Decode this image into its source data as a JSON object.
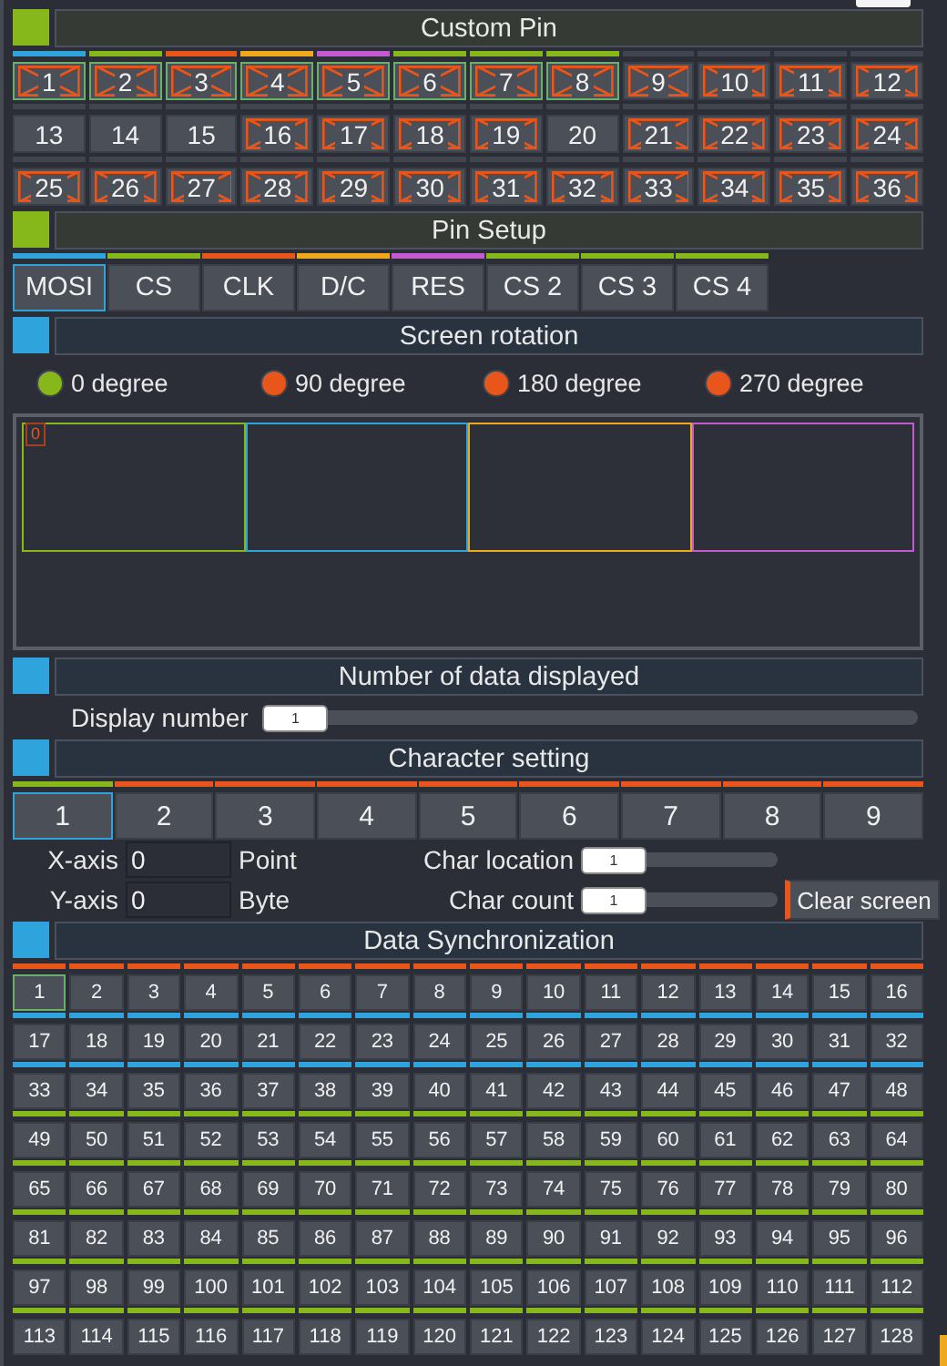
{
  "custom_pin": {
    "title": "Custom Pin",
    "color": "#86b81c",
    "pins": [
      {
        "label": "1",
        "color": "#2ea3dc",
        "crossed": true,
        "assigned": true
      },
      {
        "label": "2",
        "color": "#86b81c",
        "crossed": true,
        "assigned": true
      },
      {
        "label": "3",
        "color": "#e8561c",
        "crossed": true,
        "assigned": true
      },
      {
        "label": "4",
        "color": "#f0a81c",
        "crossed": true,
        "assigned": true
      },
      {
        "label": "5",
        "color": "#c45ad0",
        "crossed": true,
        "assigned": true
      },
      {
        "label": "6",
        "color": "#86b81c",
        "crossed": true,
        "assigned": true
      },
      {
        "label": "7",
        "color": "#86b81c",
        "crossed": true,
        "assigned": true
      },
      {
        "label": "8",
        "color": "#86b81c",
        "crossed": true,
        "assigned": true
      },
      {
        "label": "9",
        "color": "#41464e",
        "crossed": true,
        "assigned": false
      },
      {
        "label": "10",
        "color": "#41464e",
        "crossed": true,
        "assigned": false
      },
      {
        "label": "11",
        "color": "#41464e",
        "crossed": true,
        "assigned": false
      },
      {
        "label": "12",
        "color": "#41464e",
        "crossed": true,
        "assigned": false
      },
      {
        "label": "13",
        "color": "#41464e",
        "crossed": false,
        "assigned": false
      },
      {
        "label": "14",
        "color": "#41464e",
        "crossed": false,
        "assigned": false
      },
      {
        "label": "15",
        "color": "#41464e",
        "crossed": false,
        "assigned": false
      },
      {
        "label": "16",
        "color": "#41464e",
        "crossed": true,
        "assigned": false
      },
      {
        "label": "17",
        "color": "#41464e",
        "crossed": true,
        "assigned": false
      },
      {
        "label": "18",
        "color": "#41464e",
        "crossed": true,
        "assigned": false
      },
      {
        "label": "19",
        "color": "#41464e",
        "crossed": true,
        "assigned": false
      },
      {
        "label": "20",
        "color": "#41464e",
        "crossed": false,
        "assigned": false
      },
      {
        "label": "21",
        "color": "#41464e",
        "crossed": true,
        "assigned": false
      },
      {
        "label": "22",
        "color": "#41464e",
        "crossed": true,
        "assigned": false
      },
      {
        "label": "23",
        "color": "#41464e",
        "crossed": true,
        "assigned": false
      },
      {
        "label": "24",
        "color": "#41464e",
        "crossed": true,
        "assigned": false
      },
      {
        "label": "25",
        "color": "#41464e",
        "crossed": true,
        "assigned": false
      },
      {
        "label": "26",
        "color": "#41464e",
        "crossed": true,
        "assigned": false
      },
      {
        "label": "27",
        "color": "#41464e",
        "crossed": true,
        "assigned": false
      },
      {
        "label": "28",
        "color": "#41464e",
        "crossed": true,
        "assigned": false
      },
      {
        "label": "29",
        "color": "#41464e",
        "crossed": true,
        "assigned": false
      },
      {
        "label": "30",
        "color": "#41464e",
        "crossed": true,
        "assigned": false
      },
      {
        "label": "31",
        "color": "#41464e",
        "crossed": true,
        "assigned": false
      },
      {
        "label": "32",
        "color": "#41464e",
        "crossed": true,
        "assigned": false
      },
      {
        "label": "33",
        "color": "#41464e",
        "crossed": true,
        "assigned": false
      },
      {
        "label": "34",
        "color": "#41464e",
        "crossed": true,
        "assigned": false
      },
      {
        "label": "35",
        "color": "#41464e",
        "crossed": true,
        "assigned": false
      },
      {
        "label": "36",
        "color": "#41464e",
        "crossed": true,
        "assigned": false
      }
    ]
  },
  "pin_setup": {
    "title": "Pin Setup",
    "color": "#86b81c",
    "tabs": [
      {
        "label": "MOSI",
        "color": "#2ea3dc",
        "selected": true
      },
      {
        "label": "CS",
        "color": "#86b81c",
        "selected": false
      },
      {
        "label": "CLK",
        "color": "#e8561c",
        "selected": false
      },
      {
        "label": "D/C",
        "color": "#f0a81c",
        "selected": false
      },
      {
        "label": "RES",
        "color": "#c45ad0",
        "selected": false
      },
      {
        "label": "CS 2",
        "color": "#86b81c",
        "selected": false
      },
      {
        "label": "CS 3",
        "color": "#86b81c",
        "selected": false
      },
      {
        "label": "CS 4",
        "color": "#86b81c",
        "selected": false
      }
    ]
  },
  "screen_rotation": {
    "title": "Screen rotation",
    "color": "#2ea3dc",
    "options": [
      {
        "label": "0 degree",
        "selected": true
      },
      {
        "label": "90 degree",
        "selected": false
      },
      {
        "label": "180 degree",
        "selected": false
      },
      {
        "label": "270 degree",
        "selected": false
      }
    ],
    "preview": {
      "marker": "0",
      "screens": [
        {
          "color": "#86b81c"
        },
        {
          "color": "#2ea3dc"
        },
        {
          "color": "#f0a81c"
        },
        {
          "color": "#c45ad0"
        }
      ]
    }
  },
  "number_of_data": {
    "title": "Number of data displayed",
    "color": "#2ea3dc",
    "label": "Display number",
    "value": "1",
    "level": 0
  },
  "character_setting": {
    "title": "Character setting",
    "color": "#2ea3dc",
    "tabs": [
      {
        "label": "1",
        "selected": true
      },
      {
        "label": "2",
        "selected": false
      },
      {
        "label": "3",
        "selected": false
      },
      {
        "label": "4",
        "selected": false
      },
      {
        "label": "5",
        "selected": false
      },
      {
        "label": "6",
        "selected": false
      },
      {
        "label": "7",
        "selected": false
      },
      {
        "label": "8",
        "selected": false
      },
      {
        "label": "9",
        "selected": false
      }
    ],
    "x_axis": {
      "label": "X-axis",
      "value": "0",
      "unit": "Point"
    },
    "y_axis": {
      "label": "Y-axis",
      "value": "0",
      "unit": "Byte"
    },
    "char_location": {
      "label": "Char location",
      "value": "1",
      "level": 0
    },
    "char_count": {
      "label": "Char count",
      "value": "1",
      "level": 0
    },
    "clear_button": "Clear screen"
  },
  "data_sync": {
    "title": "Data Synchronization",
    "color": "#2ea3dc",
    "rows": [
      {
        "color": "#e8561c",
        "cells": [
          {
            "label": "1",
            "selected": true
          },
          {
            "label": "2",
            "selected": false
          },
          {
            "label": "3",
            "selected": false
          },
          {
            "label": "4",
            "selected": false
          },
          {
            "label": "5",
            "selected": false
          },
          {
            "label": "6",
            "selected": false
          },
          {
            "label": "7",
            "selected": false
          },
          {
            "label": "8",
            "selected": false
          },
          {
            "label": "9",
            "selected": false
          },
          {
            "label": "10",
            "selected": false
          },
          {
            "label": "11",
            "selected": false
          },
          {
            "label": "12",
            "selected": false
          },
          {
            "label": "13",
            "selected": false
          },
          {
            "label": "14",
            "selected": false
          },
          {
            "label": "15",
            "selected": false
          },
          {
            "label": "16",
            "selected": false
          }
        ]
      },
      {
        "color": "#2ea3dc",
        "cells": [
          {
            "label": "17",
            "selected": false
          },
          {
            "label": "18",
            "selected": false
          },
          {
            "label": "19",
            "selected": false
          },
          {
            "label": "20",
            "selected": false
          },
          {
            "label": "21",
            "selected": false
          },
          {
            "label": "22",
            "selected": false
          },
          {
            "label": "23",
            "selected": false
          },
          {
            "label": "24",
            "selected": false
          },
          {
            "label": "25",
            "selected": false
          },
          {
            "label": "26",
            "selected": false
          },
          {
            "label": "27",
            "selected": false
          },
          {
            "label": "28",
            "selected": false
          },
          {
            "label": "29",
            "selected": false
          },
          {
            "label": "30",
            "selected": false
          },
          {
            "label": "31",
            "selected": false
          },
          {
            "label": "32",
            "selected": false
          }
        ]
      },
      {
        "color": "#2ea3dc",
        "cells": [
          {
            "label": "33",
            "selected": false
          },
          {
            "label": "34",
            "selected": false
          },
          {
            "label": "35",
            "selected": false
          },
          {
            "label": "36",
            "selected": false
          },
          {
            "label": "37",
            "selected": false
          },
          {
            "label": "38",
            "selected": false
          },
          {
            "label": "39",
            "selected": false
          },
          {
            "label": "40",
            "selected": false
          },
          {
            "label": "41",
            "selected": false
          },
          {
            "label": "42",
            "selected": false
          },
          {
            "label": "43",
            "selected": false
          },
          {
            "label": "44",
            "selected": false
          },
          {
            "label": "45",
            "selected": false
          },
          {
            "label": "46",
            "selected": false
          },
          {
            "label": "47",
            "selected": false
          },
          {
            "label": "48",
            "selected": false
          }
        ]
      },
      {
        "color": "#86b81c",
        "cells": [
          {
            "label": "49",
            "selected": false
          },
          {
            "label": "50",
            "selected": false
          },
          {
            "label": "51",
            "selected": false
          },
          {
            "label": "52",
            "selected": false
          },
          {
            "label": "53",
            "selected": false
          },
          {
            "label": "54",
            "selected": false
          },
          {
            "label": "55",
            "selected": false
          },
          {
            "label": "56",
            "selected": false
          },
          {
            "label": "57",
            "selected": false
          },
          {
            "label": "58",
            "selected": false
          },
          {
            "label": "59",
            "selected": false
          },
          {
            "label": "60",
            "selected": false
          },
          {
            "label": "61",
            "selected": false
          },
          {
            "label": "62",
            "selected": false
          },
          {
            "label": "63",
            "selected": false
          },
          {
            "label": "64",
            "selected": false
          }
        ]
      },
      {
        "color": "#86b81c",
        "cells": [
          {
            "label": "65",
            "selected": false
          },
          {
            "label": "66",
            "selected": false
          },
          {
            "label": "67",
            "selected": false
          },
          {
            "label": "68",
            "selected": false
          },
          {
            "label": "69",
            "selected": false
          },
          {
            "label": "70",
            "selected": false
          },
          {
            "label": "71",
            "selected": false
          },
          {
            "label": "72",
            "selected": false
          },
          {
            "label": "73",
            "selected": false
          },
          {
            "label": "74",
            "selected": false
          },
          {
            "label": "75",
            "selected": false
          },
          {
            "label": "76",
            "selected": false
          },
          {
            "label": "77",
            "selected": false
          },
          {
            "label": "78",
            "selected": false
          },
          {
            "label": "79",
            "selected": false
          },
          {
            "label": "80",
            "selected": false
          }
        ]
      },
      {
        "color": "#86b81c",
        "cells": [
          {
            "label": "81",
            "selected": false
          },
          {
            "label": "82",
            "selected": false
          },
          {
            "label": "83",
            "selected": false
          },
          {
            "label": "84",
            "selected": false
          },
          {
            "label": "85",
            "selected": false
          },
          {
            "label": "86",
            "selected": false
          },
          {
            "label": "87",
            "selected": false
          },
          {
            "label": "88",
            "selected": false
          },
          {
            "label": "89",
            "selected": false
          },
          {
            "label": "90",
            "selected": false
          },
          {
            "label": "91",
            "selected": false
          },
          {
            "label": "92",
            "selected": false
          },
          {
            "label": "93",
            "selected": false
          },
          {
            "label": "94",
            "selected": false
          },
          {
            "label": "95",
            "selected": false
          },
          {
            "label": "96",
            "selected": false
          }
        ]
      },
      {
        "color": "#86b81c",
        "cells": [
          {
            "label": "97",
            "selected": false
          },
          {
            "label": "98",
            "selected": false
          },
          {
            "label": "99",
            "selected": false
          },
          {
            "label": "100",
            "selected": false
          },
          {
            "label": "101",
            "selected": false
          },
          {
            "label": "102",
            "selected": false
          },
          {
            "label": "103",
            "selected": false
          },
          {
            "label": "104",
            "selected": false
          },
          {
            "label": "105",
            "selected": false
          },
          {
            "label": "106",
            "selected": false
          },
          {
            "label": "107",
            "selected": false
          },
          {
            "label": "108",
            "selected": false
          },
          {
            "label": "109",
            "selected": false
          },
          {
            "label": "110",
            "selected": false
          },
          {
            "label": "111",
            "selected": false
          },
          {
            "label": "112",
            "selected": false
          }
        ]
      },
      {
        "color": "#86b81c",
        "cells": [
          {
            "label": "113",
            "selected": false
          },
          {
            "label": "114",
            "selected": false
          },
          {
            "label": "115",
            "selected": false
          },
          {
            "label": "116",
            "selected": false
          },
          {
            "label": "117",
            "selected": false
          },
          {
            "label": "118",
            "selected": false
          },
          {
            "label": "119",
            "selected": false
          },
          {
            "label": "120",
            "selected": false
          },
          {
            "label": "121",
            "selected": false
          },
          {
            "label": "122",
            "selected": false
          },
          {
            "label": "123",
            "selected": false
          },
          {
            "label": "124",
            "selected": false
          },
          {
            "label": "125",
            "selected": false
          },
          {
            "label": "126",
            "selected": false
          },
          {
            "label": "127",
            "selected": false
          },
          {
            "label": "128",
            "selected": false
          }
        ]
      }
    ]
  }
}
